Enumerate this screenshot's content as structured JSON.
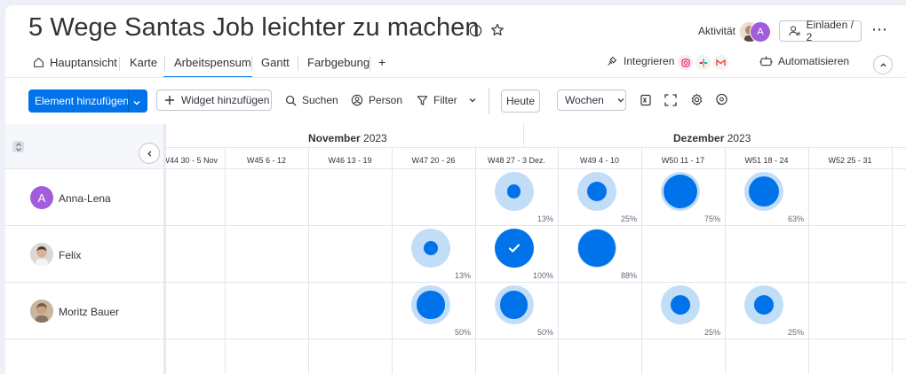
{
  "board": {
    "title": "5 Wege Santas Job leichter zu machen"
  },
  "header": {
    "activity_label": "Aktivität",
    "avatar_letter": "A",
    "invite_label": "Einladen / 2",
    "more_label": "⋯"
  },
  "tabs": [
    {
      "label": "Hauptansicht"
    },
    {
      "label": "Karte"
    },
    {
      "label": "Arbeitspensum"
    },
    {
      "label": "Gantt"
    },
    {
      "label": "Farbgebung"
    },
    {
      "label": "+"
    }
  ],
  "integrations": {
    "integrate_label": "Integrieren",
    "automate_label": "Automatisieren"
  },
  "toolbar": {
    "add_item_label": "Element hinzufügen",
    "add_widget_label": "Widget hinzufügen",
    "search_label": "Suchen",
    "person_label": "Person",
    "filter_label": "Filter",
    "today_label": "Heute",
    "scale_label": "Wochen"
  },
  "timeline": {
    "months": [
      {
        "name": "November",
        "year": "2023"
      },
      {
        "name": "Dezember",
        "year": "2023"
      }
    ],
    "weeks": [
      "W44 30 - 5 Nov.",
      "W45 6 - 12",
      "W46 13 - 19",
      "W47 20 - 26",
      "W48 27 - 3 Dez.",
      "W49 4 - 10",
      "W50 11 - 17",
      "W51 18 - 24",
      "W52 25 - 31"
    ]
  },
  "people": [
    {
      "name": "Anna-Lena",
      "avatar_letter": "A",
      "workloads": [
        {
          "week": 4,
          "percent": 13,
          "label": "13%"
        },
        {
          "week": 5,
          "percent": 25,
          "label": "25%"
        },
        {
          "week": 6,
          "percent": 75,
          "label": "75%"
        },
        {
          "week": 7,
          "percent": 63,
          "label": "63%"
        }
      ]
    },
    {
      "name": "Felix",
      "avatar_letter": "",
      "workloads": [
        {
          "week": 3,
          "percent": 13,
          "label": "13%"
        },
        {
          "week": 4,
          "percent": 100,
          "label": "100%"
        },
        {
          "week": 5,
          "percent": 88,
          "label": "88%"
        }
      ]
    },
    {
      "name": "Moritz Bauer",
      "avatar_letter": "",
      "workloads": [
        {
          "week": 3,
          "percent": 50,
          "label": "50%"
        },
        {
          "week": 4,
          "percent": 50,
          "label": "50%"
        },
        {
          "week": 6,
          "percent": 25,
          "label": "25%"
        },
        {
          "week": 7,
          "percent": 25,
          "label": "25%"
        }
      ]
    }
  ],
  "colors": {
    "accent": "#0073ea",
    "light": "#c2ddf7",
    "purple": "#a25ddc"
  }
}
